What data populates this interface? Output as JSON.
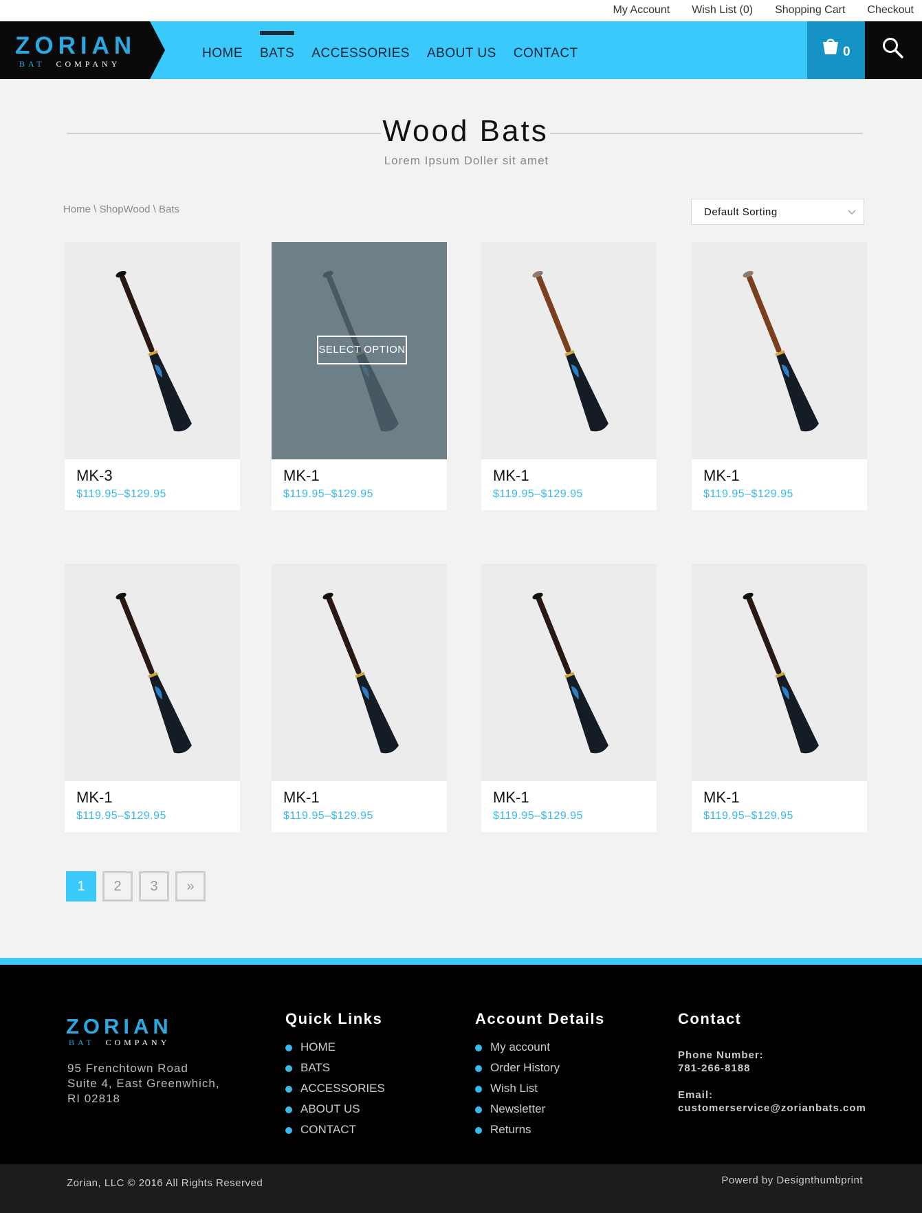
{
  "topbar": {
    "my_account": "My Account",
    "wish_list": "Wish List (0)",
    "shopping_cart": "Shopping Cart",
    "checkout": "Checkout"
  },
  "logo": {
    "main": "ZORIAN",
    "sub_a": "BAT",
    "sub_b": "COMPANY"
  },
  "nav": {
    "home": "HOME",
    "bats": "BATS",
    "accessories": "ACCESSORIES",
    "about": "ABOUT US",
    "contact": "CONTACT",
    "active": "BATS"
  },
  "cart": {
    "count": "0",
    "icon": "cart-icon"
  },
  "search": {
    "icon": "search-icon"
  },
  "page": {
    "title": "Wood  Bats",
    "subtitle": "Lorem Ipsum Doller sit amet",
    "breadcrumb": "Home \\ ShopWood \\ Bats",
    "sort_value": "Default  Sorting"
  },
  "products": [
    {
      "name": "MK-3",
      "price": "$119.95–$129.95",
      "barrel": "dark"
    },
    {
      "name": "MK-1",
      "price": "$119.95–$129.95",
      "barrel": "dark",
      "hover": true,
      "hover_label": "SELECT OPTION"
    },
    {
      "name": "MK-1",
      "price": "$119.95–$129.95",
      "barrel": "brown"
    },
    {
      "name": "MK-1",
      "price": "$119.95–$129.95",
      "barrel": "brown"
    },
    {
      "name": "MK-1",
      "price": "$119.95–$129.95",
      "barrel": "dark"
    },
    {
      "name": "MK-1",
      "price": "$119.95–$129.95",
      "barrel": "dark"
    },
    {
      "name": "MK-1",
      "price": "$119.95–$129.95",
      "barrel": "dark"
    },
    {
      "name": "MK-1",
      "price": "$119.95–$129.95",
      "barrel": "dark"
    }
  ],
  "pagination": {
    "p1": "1",
    "p2": "2",
    "p3": "3",
    "next": "»",
    "current": "1"
  },
  "footer": {
    "address_1": "95 Frenchtown Road",
    "address_2": "Suite 4, East Greenwhich,",
    "address_3": "RI 02818",
    "quick_links_title": "Quick Links",
    "quick_links": [
      "HOME",
      "BATS",
      "ACCESSORIES",
      "ABOUT US",
      "CONTACT"
    ],
    "account_title": "Account Details",
    "account_links": [
      "My account",
      "Order History",
      "Wish List",
      "Newsletter",
      "Returns"
    ],
    "contact_title": "Contact",
    "phone_label": "Phone Number:",
    "phone": "781-266-8188",
    "email_label": "Email:",
    "email": "customerservice@zorianbats.com",
    "copyright": "Zorian, LLC © 2016 All Rights Reserved",
    "powered": "Powerd by Designthumbprint"
  },
  "colors": {
    "accent": "#39c9fb",
    "accent_dark": "#1592c6",
    "price": "#39b9ec",
    "black": "#0a0a0a"
  }
}
